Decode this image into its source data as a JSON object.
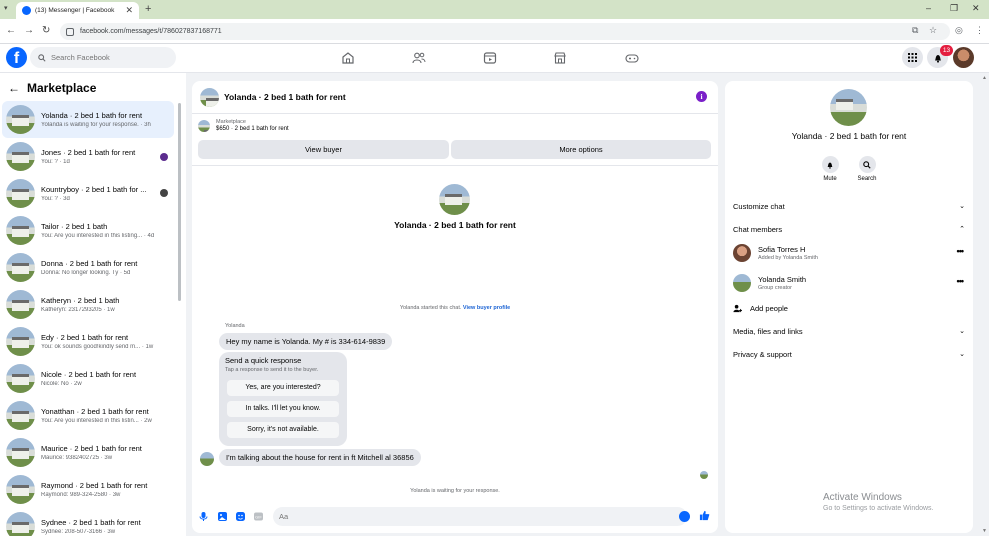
{
  "browser": {
    "tab_title": "(13) Messenger | Facebook",
    "url": "facebook.com/messages/t/786027837168771"
  },
  "header": {
    "search_placeholder": "Search Facebook",
    "notification_count": "13"
  },
  "sidebar": {
    "title": "Marketplace",
    "conversations": [
      {
        "name": "Yolanda · 2 bed 1 bath for rent",
        "preview": "Yolanda is waiting for your response. · 3h"
      },
      {
        "name": "Jones · 2 bed 1 bath for rent",
        "preview": "You: ? · 1d"
      },
      {
        "name": "Kountryboy · 2 bed 1 bath for ...",
        "preview": "You: ? · 3d"
      },
      {
        "name": "Tailor · 2 bed 1 bath",
        "preview": "You: Are you interested in this listing... · 4d"
      },
      {
        "name": "Donna · 2 bed 1 bath for rent",
        "preview": "Donna: No longer looking. Ty · 5d"
      },
      {
        "name": "Katheryn · 2 bed 1 bath",
        "preview": "Katheryn: 2317293205 · 1w"
      },
      {
        "name": "Edy · 2 bed 1 bath for rent",
        "preview": "You: ok sounds good!kindly send m... · 1w"
      },
      {
        "name": "Nicole · 2 bed 1 bath for rent",
        "preview": "Nicole: No · 2w"
      },
      {
        "name": "Yonatthan · 2 bed 1 bath for rent",
        "preview": "You: Are you interested in this listin... · 2w"
      },
      {
        "name": "Maurice · 2 bed 1 bath for rent",
        "preview": "Maurice: 9382402725 · 3w"
      },
      {
        "name": "Raymond · 2 bed 1 bath for rent",
        "preview": "Raymond: 989-324-2580 · 3w"
      },
      {
        "name": "Sydnee · 2 bed 1 bath for rent",
        "preview": "Sydnee: 208-507-3166 · 3w"
      }
    ]
  },
  "chat": {
    "title": "Yolanda · 2 bed 1 bath for rent",
    "listing_source": "Marketplace",
    "listing_price": "$650 · 2 bed 1 bath for rent",
    "view_buyer": "View buyer",
    "more_options": "More options",
    "intro_title": "Yolanda · 2 bed 1 bath for rent",
    "started_text": "Yolanda started this chat.",
    "view_buyer_profile": "View buyer profile",
    "sender": "Yolanda",
    "message1": "Hey my name is Yolanda. My # is 334-614-9839",
    "quick_title": "Send a quick response",
    "quick_sub": "Tap a response to send it to the buyer.",
    "quick_replies": [
      "Yes, are you interested?",
      "In talks. I'll let you know.",
      "Sorry, it's not available."
    ],
    "message2": "I'm talking about the house for rent in ft Mitchell al 36856",
    "waiting": "Yolanda is waiting for your response.",
    "composer_placeholder": "Aa"
  },
  "info_panel": {
    "title": "Yolanda · 2 bed 1 bath for rent",
    "mute": "Mute",
    "search": "Search",
    "customize_chat": "Customize chat",
    "chat_members": "Chat members",
    "members": [
      {
        "name": "Sofia Torres H",
        "sub": "Added by Yolanda Smith"
      },
      {
        "name": "Yolanda Smith",
        "sub": "Group creator"
      }
    ],
    "add_people": "Add people",
    "media": "Media, files and links",
    "privacy": "Privacy & support"
  },
  "watermark": {
    "title": "Activate Windows",
    "subtitle": "Go to Settings to activate Windows."
  },
  "colors": {
    "brand": "#0866ff",
    "info_purple": "#7a1fc9",
    "badge_red": "#e41e3f"
  }
}
